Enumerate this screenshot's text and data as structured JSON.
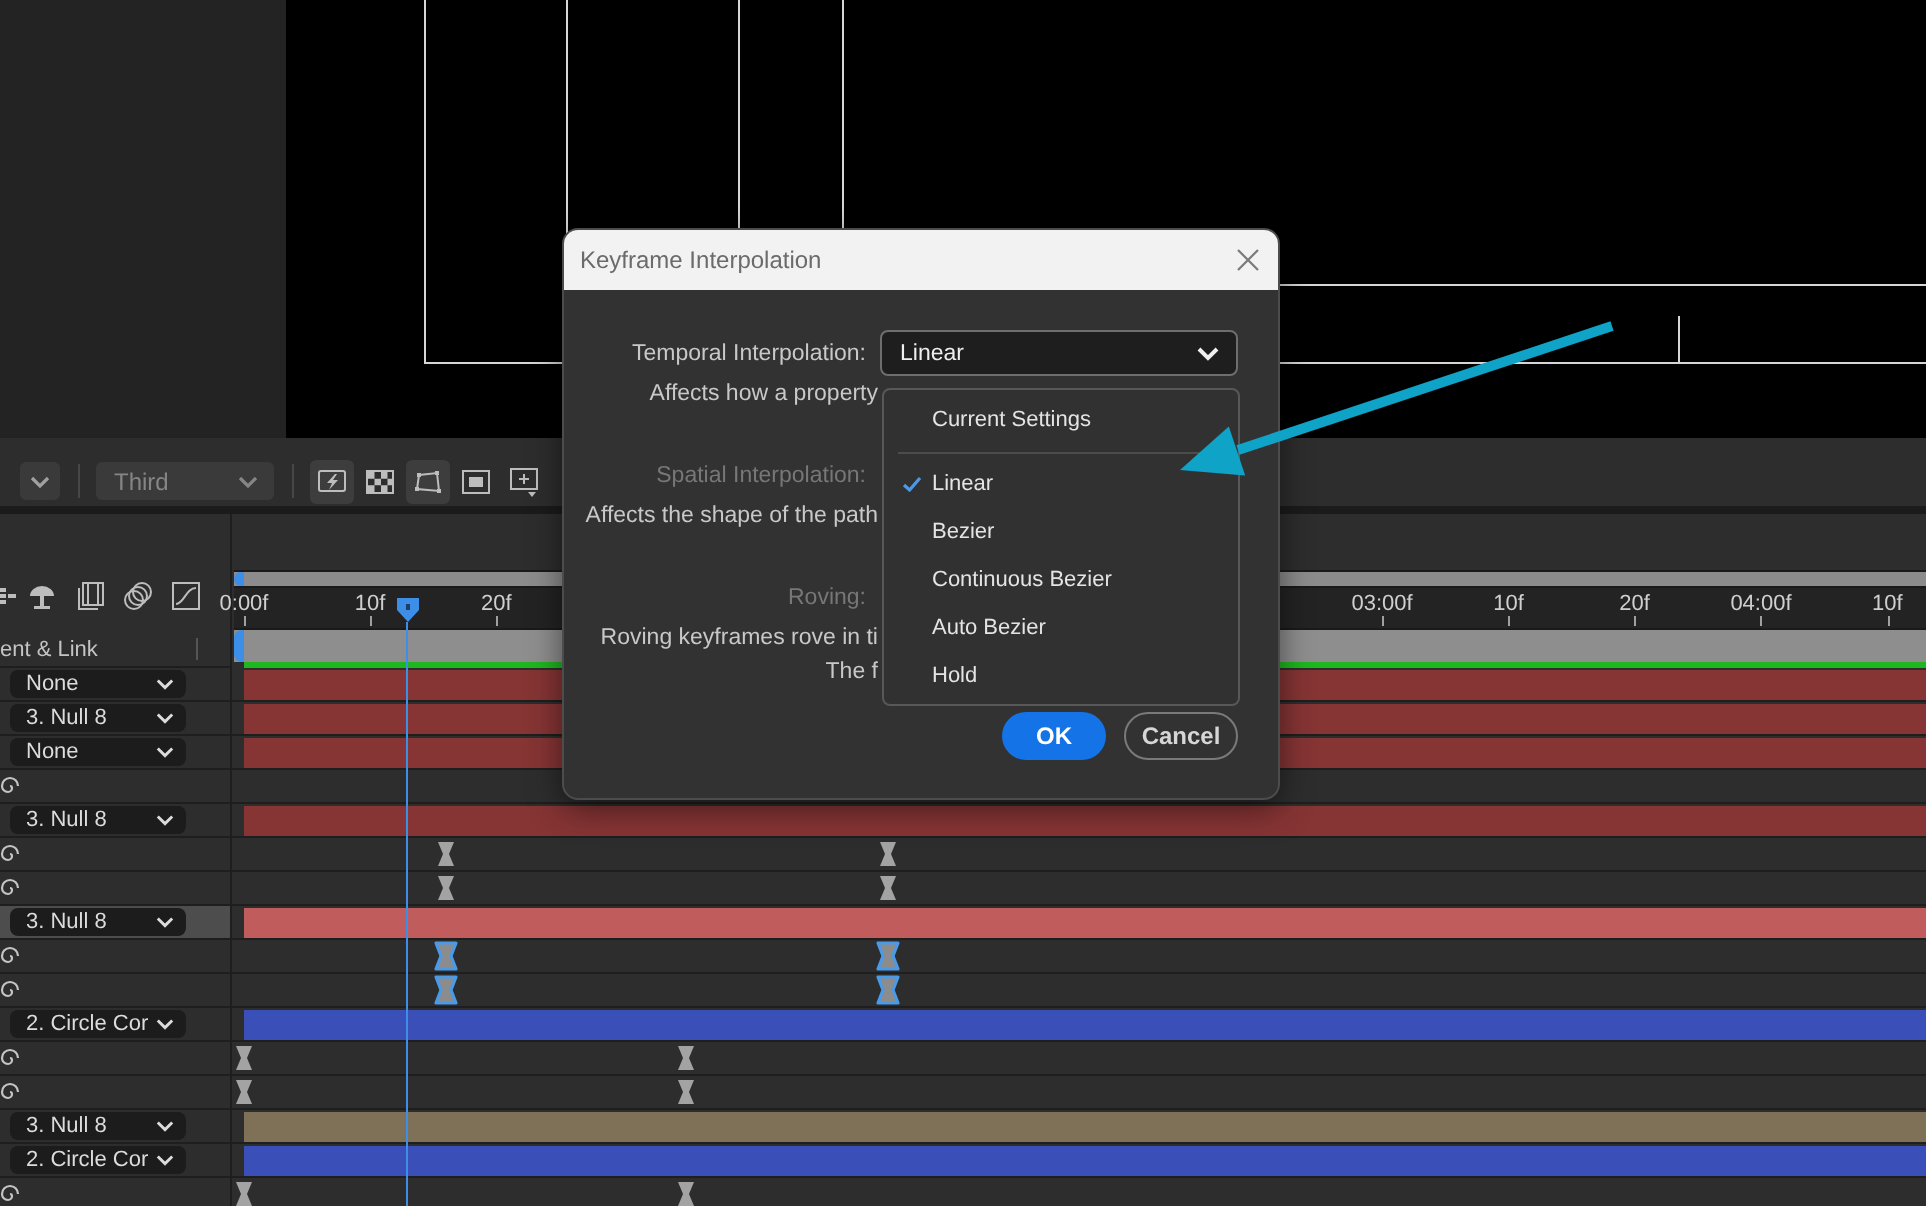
{
  "viewer_toolbar": {
    "view_dropdown": {
      "value": "Third",
      "disabled": true
    },
    "tools": [
      {
        "kind": "snapshot",
        "on": true
      },
      {
        "kind": "checkerboard",
        "on": false
      },
      {
        "kind": "region",
        "on": true
      },
      {
        "kind": "frame",
        "on": false
      },
      {
        "kind": "grid",
        "on": false
      }
    ]
  },
  "timeline": {
    "switches": [
      {
        "kind": "lines"
      },
      {
        "kind": "lamp"
      },
      {
        "kind": "film"
      },
      {
        "kind": "circles"
      },
      {
        "kind": "graph"
      }
    ],
    "column_header": "ent & Link",
    "ruler": {
      "labels": [
        {
          "text": "0:00f",
          "level": 0
        },
        {
          "text": "10f",
          "level": 0.075
        },
        {
          "text": "20f",
          "level": 0.15
        },
        {
          "text": "03:00f",
          "level": 0.6766
        },
        {
          "text": "10f",
          "level": 0.7518
        },
        {
          "text": "20f",
          "level": 0.8268
        },
        {
          "text": "04:00f",
          "level": 0.9019
        },
        {
          "text": "10f",
          "level": 0.977
        }
      ]
    },
    "playhead": {
      "level": 0.0975
    },
    "rows": [
      {
        "kind": "layer",
        "parent": "None",
        "color": "#863434",
        "selected": false
      },
      {
        "kind": "layer",
        "parent": "3. Null 8",
        "color": "#863434",
        "selected": false
      },
      {
        "kind": "layer",
        "parent": "None",
        "color": "#863434",
        "selected": false
      },
      {
        "kind": "property",
        "selected": false
      },
      {
        "kind": "layer",
        "parent": "3. Null 8",
        "color": "#863434",
        "selected": false
      },
      {
        "kind": "property",
        "selected": false,
        "keyframes": [
          {
            "level": 0.1201,
            "selected": false
          },
          {
            "level": 0.3829,
            "selected": false
          }
        ]
      },
      {
        "kind": "property",
        "selected": false,
        "keyframes": [
          {
            "level": 0.1201,
            "selected": false
          },
          {
            "level": 0.3829,
            "selected": false
          }
        ]
      },
      {
        "kind": "layer",
        "parent": "3. Null 8",
        "color": "#c05c5c",
        "selected": true
      },
      {
        "kind": "property",
        "selected": false,
        "keyframes": [
          {
            "level": 0.1201,
            "selected": true
          },
          {
            "level": 0.3829,
            "selected": true
          }
        ]
      },
      {
        "kind": "property",
        "selected": false,
        "keyframes": [
          {
            "level": 0.1201,
            "selected": true
          },
          {
            "level": 0.3829,
            "selected": true
          }
        ]
      },
      {
        "kind": "layer",
        "parent": "2. Circle Cor",
        "color": "#3a4fb8",
        "selected": false
      },
      {
        "kind": "property",
        "selected": false,
        "keyframes": [
          {
            "level": 0,
            "selected": false
          },
          {
            "level": 0.2628,
            "selected": false
          }
        ]
      },
      {
        "kind": "property",
        "selected": false,
        "keyframes": [
          {
            "level": 0,
            "selected": false
          },
          {
            "level": 0.2628,
            "selected": false
          }
        ]
      },
      {
        "kind": "layer",
        "parent": "3. Null 8",
        "color": "#7f7058",
        "selected": false
      },
      {
        "kind": "layer",
        "parent": "2. Circle Cor",
        "color": "#3a4fb8",
        "selected": false
      },
      {
        "kind": "property",
        "selected": false,
        "keyframes": [
          {
            "level": 0,
            "selected": false
          },
          {
            "level": 0.2628,
            "selected": false
          }
        ]
      }
    ]
  },
  "dialog": {
    "title": "Keyframe Interpolation",
    "sections": [
      {
        "label": "Temporal Interpolation:",
        "disabled": false,
        "value": "Linear",
        "description": [
          "Affects how a property"
        ]
      },
      {
        "label": "Spatial Interpolation:",
        "disabled": true,
        "description": [
          "Affects the shape of the path"
        ]
      },
      {
        "label": "Roving:",
        "disabled": true,
        "description": [
          "Roving keyframes rove in ti",
          "The f"
        ]
      }
    ],
    "menu": {
      "items": [
        {
          "kind": "option",
          "label": "Current Settings",
          "selected": false
        },
        {
          "kind": "separator"
        },
        {
          "kind": "option",
          "label": "Linear",
          "selected": true
        },
        {
          "kind": "option",
          "label": "Bezier",
          "selected": false
        },
        {
          "kind": "option",
          "label": "Continuous Bezier",
          "selected": false
        },
        {
          "kind": "option",
          "label": "Auto Bezier",
          "selected": false
        },
        {
          "kind": "option",
          "label": "Hold",
          "selected": false
        }
      ]
    },
    "buttons": [
      {
        "kind": "primary",
        "label": "OK"
      },
      {
        "kind": "secondary",
        "label": "Cancel"
      }
    ]
  }
}
